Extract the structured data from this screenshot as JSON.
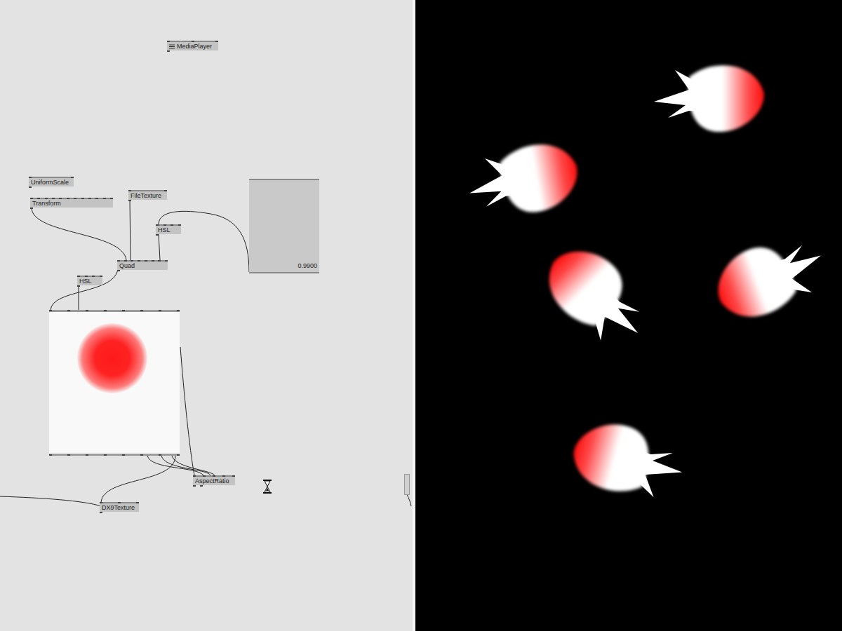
{
  "nodes": [
    {
      "label": "MediaPlayer"
    },
    {
      "label": "UniformScale"
    },
    {
      "label": "Transform"
    },
    {
      "label": "FileTexture"
    },
    {
      "label": "HSL"
    },
    {
      "label": "Quad"
    },
    {
      "label": "HSL"
    },
    {
      "label": "AspectRatio"
    },
    {
      "label": "DX9Texture"
    }
  ],
  "value_box": {
    "reading": "0.9900"
  }
}
